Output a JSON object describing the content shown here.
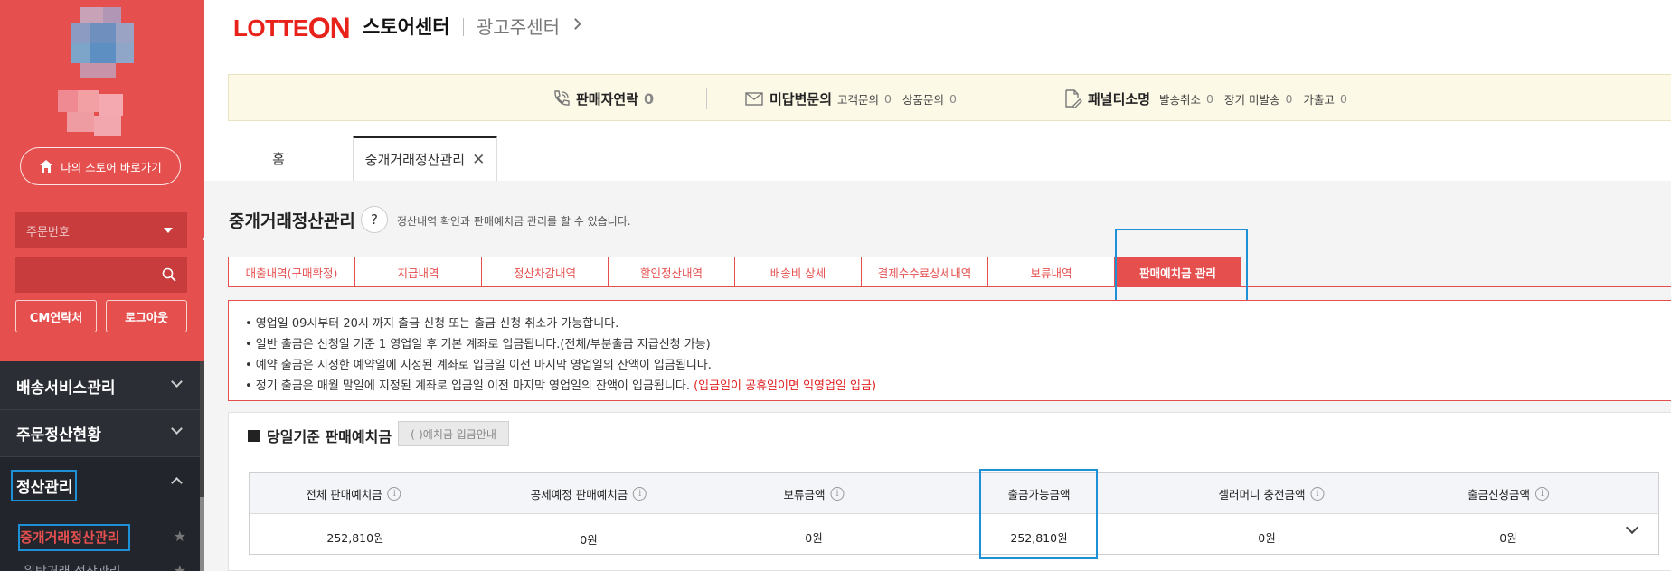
{
  "sidebar": {
    "store_button_label": "나의 스토어 바로가기",
    "search_select": "주문번호",
    "search_value": "",
    "cm_contact_label": "CM연락처",
    "logout_label": "로그아웃",
    "menu": [
      {
        "label": "배송서비스관리"
      },
      {
        "label": "주문정산현황"
      },
      {
        "label": "정산관리"
      }
    ],
    "submenu_active": "중개거래정산관리",
    "submenu_next": "위탁거래 정산관리"
  },
  "header": {
    "logo_text": "LOTTE",
    "logo_on": "ON",
    "store_center": "스토어센터",
    "ad_center": "광고주센터"
  },
  "notice": {
    "seller_contact": {
      "title": "판매자연락",
      "count": "0"
    },
    "unanswered": {
      "title": "미답변문의",
      "customer_label": "고객문의",
      "customer_count": "0",
      "product_label": "상품문의",
      "product_count": "0"
    },
    "penalty": {
      "title": "패널티소명",
      "cancel_label": "발송취소",
      "cancel_count": "0",
      "longdelay_label": "장기 미발송",
      "longdelay_count": "0",
      "fake_label": "가출고",
      "fake_count": "0"
    }
  },
  "tabs": {
    "home": "홈",
    "active": "중개거래정산관리",
    "close": "✕"
  },
  "page": {
    "title": "중개거래정산관리",
    "help": "?",
    "description": "정산내역 확인과 판매예치금 관리를 할 수 있습니다."
  },
  "subtabs": [
    "매출내역(구매확정)",
    "지급내역",
    "정산차감내역",
    "할인정산내역",
    "배송비 상세",
    "결제수수료상세내역",
    "보류내역",
    "판매예치금 관리"
  ],
  "info_lines": [
    "• 영업일 09시부터 20시 까지 출금 신청 또는 출금 신청 취소가 가능합니다.",
    "• 일반 출금은 신청일 기준 1 영업일 후 기본 계좌로 입금됩니다.(전체/부분출금 지급신청 가능)",
    "• 예약 출금은 지정한 예약일에 지정된 계좌로 입금일 이전 마지막 영업일의 잔액이 입금됩니다.",
    "• 정기 출금은 매월 말일에 지정된 계좌로 입금일 이전 마지막 영업일의 잔액이 입금됩니다."
  ],
  "info_note": "(입금일이 공휴일이면 익영업일 입금)",
  "panel": {
    "title": "당일기준 판매예치금",
    "guide_button": "(-)예치금 입금안내"
  },
  "table": {
    "headers": [
      "전체 판매예치금",
      "공제예정 판매예치금",
      "보류금액",
      "출금가능금액",
      "셀러머니 충전금액",
      "출금신청금액"
    ],
    "values": [
      "252,810원",
      "0원",
      "0원",
      "252,810원",
      "0원",
      "0원"
    ]
  },
  "colors": {
    "brand": "#e5504f",
    "sidebar_dark": "#2b2e35",
    "highlight": "#1e90d6"
  }
}
